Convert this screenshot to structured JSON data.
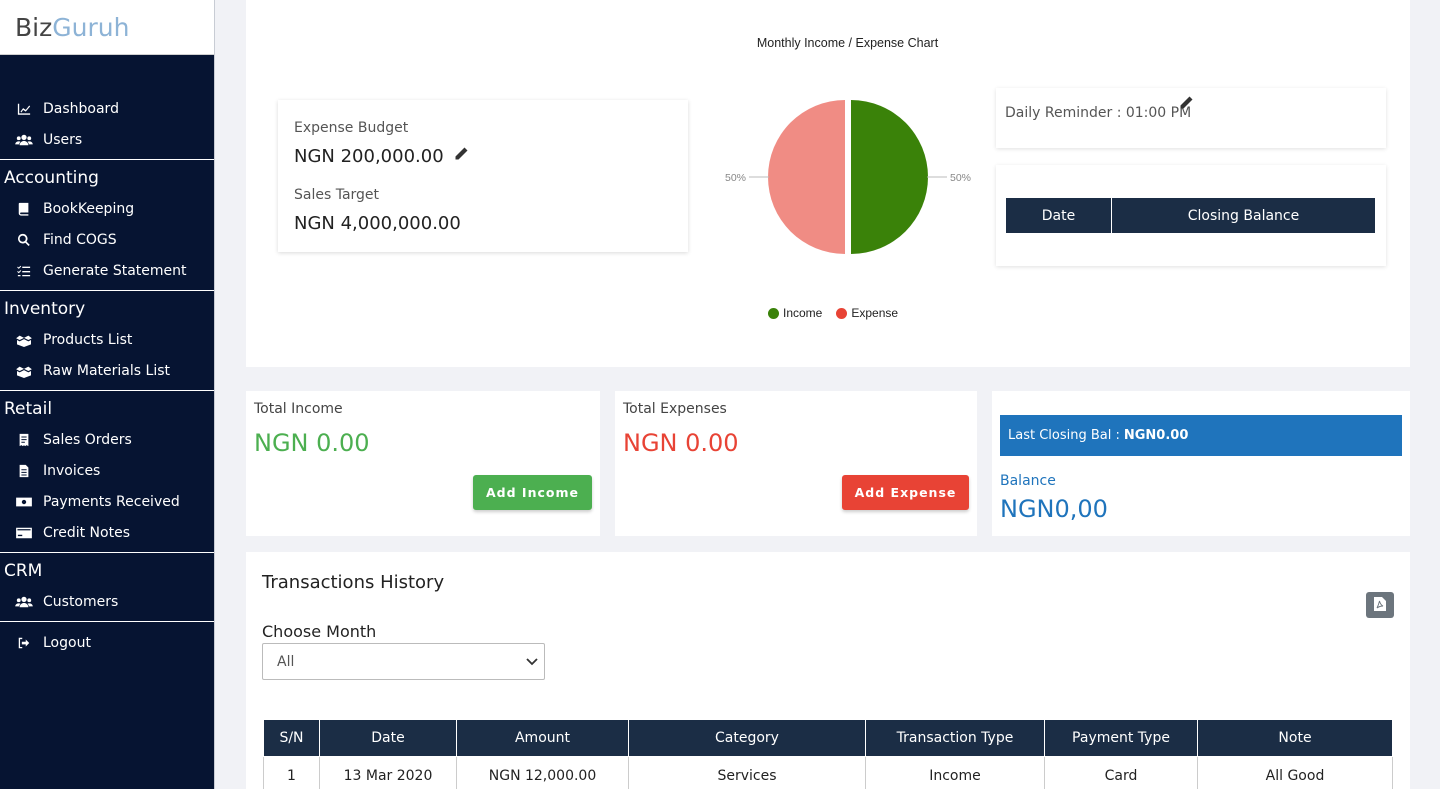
{
  "brand": {
    "part1": "Biz",
    "part2": "Guruh"
  },
  "sidebar": {
    "top_items": [
      {
        "label": "Dashboard",
        "icon": "chart-line-icon"
      },
      {
        "label": "Users",
        "icon": "users-icon"
      }
    ],
    "sections": [
      {
        "title": "Accounting",
        "items": [
          {
            "label": "BookKeeping",
            "icon": "book-icon"
          },
          {
            "label": "Find COGS",
            "icon": "search-icon"
          },
          {
            "label": "Generate Statement",
            "icon": "list-check-icon"
          }
        ]
      },
      {
        "title": "Inventory",
        "items": [
          {
            "label": "Products List",
            "icon": "boxes-icon"
          },
          {
            "label": "Raw Materials List",
            "icon": "boxes-icon"
          }
        ]
      },
      {
        "title": "Retail",
        "items": [
          {
            "label": "Sales Orders",
            "icon": "receipt-icon"
          },
          {
            "label": "Invoices",
            "icon": "file-invoice-icon"
          },
          {
            "label": "Payments Received",
            "icon": "money-bill-icon"
          },
          {
            "label": "Credit Notes",
            "icon": "credit-card-icon"
          }
        ]
      },
      {
        "title": "CRM",
        "items": [
          {
            "label": "Customers",
            "icon": "users-icon"
          }
        ]
      }
    ],
    "logout": {
      "label": "Logout",
      "icon": "sign-out-icon"
    }
  },
  "budget": {
    "expense_label": "Expense Budget",
    "expense_value": "NGN 200,000.00",
    "sales_label": "Sales Target",
    "sales_value": "NGN 4,000,000.00"
  },
  "chart_data": {
    "type": "pie",
    "title": "Monthly Income / Expense Chart",
    "slices": [
      {
        "name": "Income",
        "value": 50,
        "label": "50%",
        "color": "#3a8209"
      },
      {
        "name": "Expense",
        "value": 50,
        "label": "50%",
        "color": "#f08c84"
      }
    ],
    "legend": [
      {
        "name": "Income",
        "color": "#3a8209"
      },
      {
        "name": "Expense",
        "color": "#e84335"
      }
    ],
    "legend_position": "bottom"
  },
  "reminder": {
    "text": "Daily Reminder : 01:00 PM"
  },
  "closing_table": {
    "headers": [
      "Date",
      "Closing Balance"
    ]
  },
  "income": {
    "label": "Total Income",
    "amount": "NGN 0.00",
    "button": "Add Income",
    "color": "#4caf50"
  },
  "expenses": {
    "label": "Total Expenses",
    "amount": "NGN 0.00",
    "button": "Add Expense",
    "color": "#e84335"
  },
  "balance": {
    "last_label": "Last Closing Bal :",
    "last_value": "NGN0.00",
    "label": "Balance",
    "value": "NGN0,00",
    "color": "#1f74bc"
  },
  "transactions": {
    "title": "Transactions History",
    "month_label": "Choose Month",
    "month_selected": "All",
    "headers": [
      "S/N",
      "Date",
      "Amount",
      "Category",
      "Transaction Type",
      "Payment Type",
      "Note"
    ],
    "rows": [
      [
        "1",
        "13 Mar 2020",
        "NGN 12,000.00",
        "Services",
        "Income",
        "Card",
        "All Good"
      ]
    ]
  }
}
